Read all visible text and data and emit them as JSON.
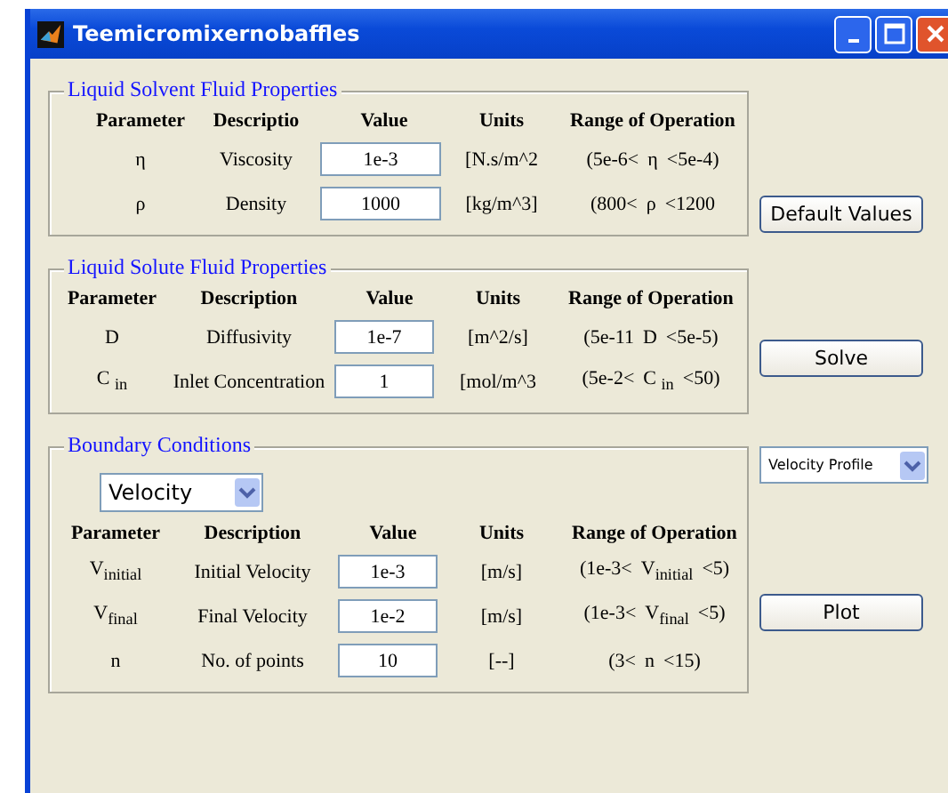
{
  "window": {
    "title": "Teemicromixernobaffles"
  },
  "panels": [
    {
      "title": "Liquid Solvent Fluid Properties",
      "columns": [
        "Parameter",
        "Descriptio",
        "Value",
        "Units",
        "Range of Operation"
      ],
      "rows": [
        {
          "symbol": "η",
          "description": "Viscosity",
          "value": "1e-3",
          "units": "[N.s/m^2",
          "range_low": "(5e-6<",
          "range_symbol": "η",
          "range_high": "<5e-4)"
        },
        {
          "symbol": "ρ",
          "description": "Density",
          "value": "1000",
          "units": "[kg/m^3]",
          "range_low": "(800<",
          "range_symbol": "ρ",
          "range_high": "<1200"
        }
      ]
    },
    {
      "title": "Liquid Solute Fluid Properties",
      "columns": [
        "Parameter",
        "Description",
        "Value",
        "Units",
        "Range of Operation"
      ],
      "rows": [
        {
          "symbol": "D",
          "description": "Diffusivity",
          "value": "1e-7",
          "units": "[m^2/s]",
          "range_low": "(5e-11",
          "range_symbol": "D",
          "range_high": "<5e-5)"
        },
        {
          "symbol": "C $_{in}$",
          "description": "Inlet Concentration",
          "value": "1",
          "units": "[mol/m^3",
          "range_low": "(5e-2<",
          "range_symbol": "C $_{in}$",
          "range_high": "<50)"
        }
      ]
    },
    {
      "title": "Boundary Conditions",
      "dropdown": {
        "value": "Velocity"
      },
      "columns": [
        "Parameter",
        "Description",
        "Value",
        "Units",
        "Range of Operation"
      ],
      "rows": [
        {
          "symbol": "V$_{initial}$",
          "description": "Initial Velocity",
          "value": "1e-3",
          "units": "[m/s]",
          "range_low": "(1e-3<",
          "range_symbol": "V$_{initial}$",
          "range_high": "<5)"
        },
        {
          "symbol": "V$_{final}$",
          "description": "Final Velocity",
          "value": "1e-2",
          "units": "[m/s]",
          "range_low": "(1e-3<",
          "range_symbol": "V$_{final}$",
          "range_high": "<5)"
        },
        {
          "symbol": "n",
          "description": "No. of points",
          "value": "10",
          "units": "[--]",
          "range_low": "(3<",
          "range_symbol": "n",
          "range_high": "<15)"
        }
      ]
    }
  ],
  "side_controls": [
    {
      "kind": "button",
      "label": "Default Values"
    },
    {
      "kind": "button",
      "label": "Solve"
    },
    {
      "kind": "dropdown",
      "label": "Velocity Profile"
    },
    {
      "kind": "button",
      "label": "Plot"
    }
  ]
}
